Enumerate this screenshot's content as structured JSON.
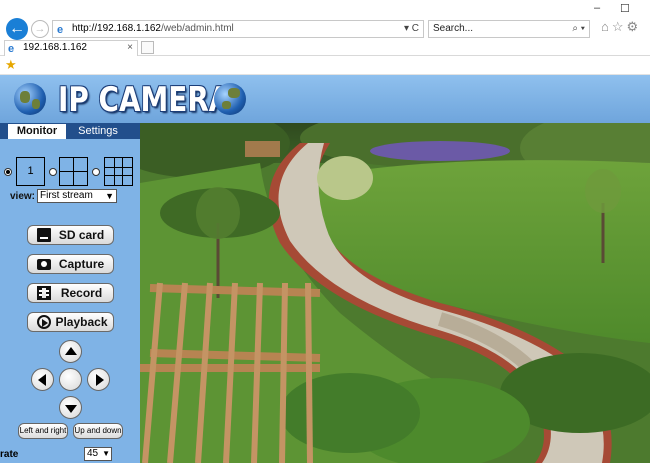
{
  "browser": {
    "url_host": "http://192.168.1.162",
    "url_path": "/web/admin.html",
    "search_placeholder": "Search...",
    "tab_title": "192.168.1.162",
    "addr_tools": "▾ C",
    "search_tools": "⌕ ▾",
    "close_glyph": "×",
    "window_min": "–",
    "window_max": "☐"
  },
  "header": {
    "title": "IP CAMERA"
  },
  "tabs": {
    "monitor": "Monitor",
    "settings": "Settings"
  },
  "layout": {
    "single_label": "1",
    "selected": "1"
  },
  "view": {
    "label": "view:",
    "selected": "First stream"
  },
  "buttons": {
    "sd_card": "SD card",
    "capture": "Capture",
    "record": "Record",
    "playback": "Playback"
  },
  "ptz": {
    "left_right": "Left and right",
    "up_down": "Up and down"
  },
  "rate": {
    "label": "rate",
    "selected": "45"
  },
  "colors": {
    "accent": "#224f8c",
    "panel": "#7fb3e6",
    "browser_blue": "#1a7fd6"
  },
  "feed": {
    "description_icon": "garden-camera-image"
  }
}
